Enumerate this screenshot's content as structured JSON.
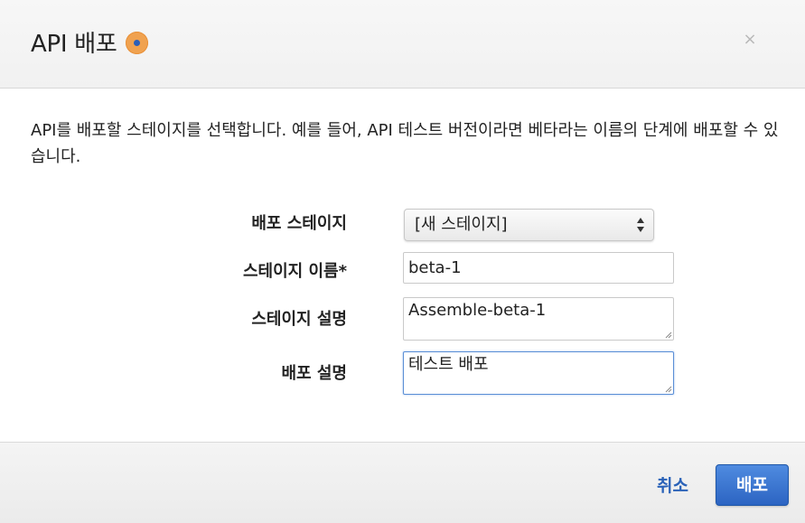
{
  "dialog": {
    "title": "API 배포",
    "title_icon": "status-dot-icon",
    "close_symbol": "×",
    "description": "API를 배포할 스테이지를 선택합니다. 예를 들어, API 테스트 버전이라면 베타라는 이름의 단계에 배포할 수 있습니다."
  },
  "form": {
    "stage": {
      "label": "배포 스테이지",
      "value": "[새 스테이지]"
    },
    "stage_name": {
      "label": "스테이지 이름*",
      "value": "beta-1"
    },
    "stage_description": {
      "label": "스테이지 설명",
      "value": "Assemble-beta-1"
    },
    "deployment_description": {
      "label": "배포 설명",
      "value": "테스트 배포"
    }
  },
  "footer": {
    "cancel_label": "취소",
    "deploy_label": "배포"
  },
  "colors": {
    "accent": "#2c64c2",
    "link": "#2a62b8",
    "icon_orange": "#f0a250",
    "icon_dot": "#2b5fb8"
  }
}
